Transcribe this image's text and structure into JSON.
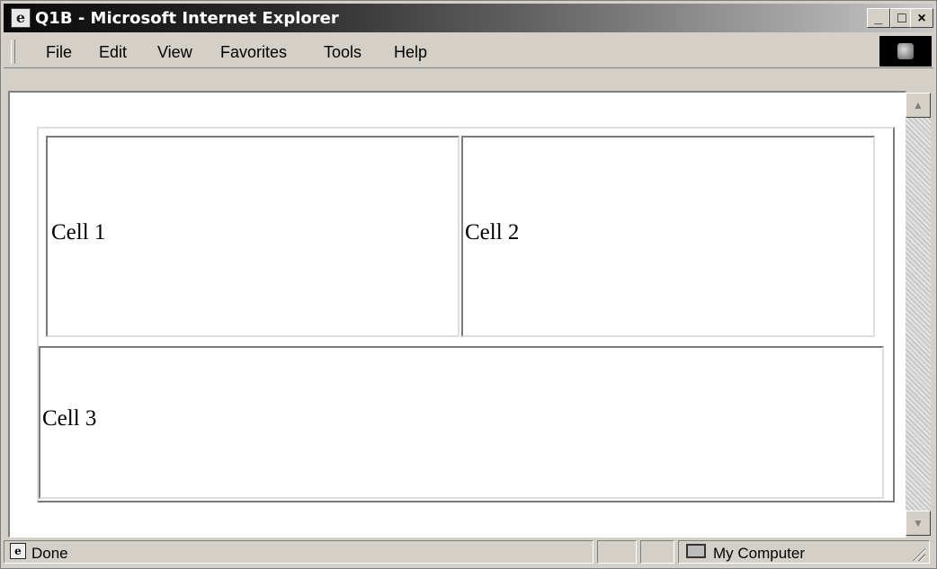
{
  "window": {
    "title": "Q1B - Microsoft Internet Explorer",
    "minimize_label": "_",
    "maximize_label": "□",
    "close_label": "×"
  },
  "menu": {
    "items": [
      {
        "label": "File"
      },
      {
        "label": "Edit"
      },
      {
        "label": "View"
      },
      {
        "label": "Favorites"
      },
      {
        "label": "Tools"
      },
      {
        "label": "Help"
      }
    ]
  },
  "table": {
    "row1": [
      "Cell 1",
      "Cell 2"
    ],
    "row2": [
      "Cell 3"
    ]
  },
  "status": {
    "text": "Done",
    "zone": "My Computer"
  },
  "icons": {
    "title": "ie-page-icon",
    "brand": "windows-logo-icon",
    "status": "ie-page-icon",
    "zone": "computer-icon"
  }
}
